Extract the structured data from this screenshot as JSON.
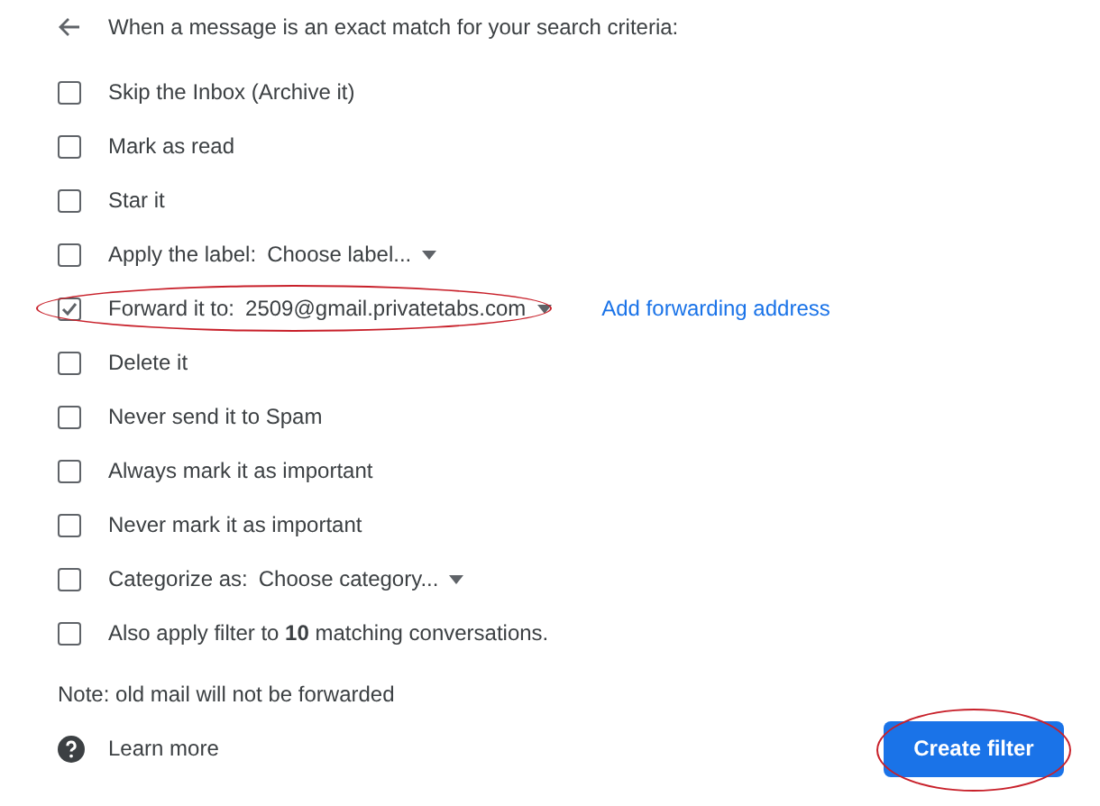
{
  "header": {
    "text": "When a message is an exact match for your search criteria:"
  },
  "actions": [
    {
      "kind": "plain",
      "label": "Skip the Inbox (Archive it)",
      "checked": false
    },
    {
      "kind": "plain",
      "label": "Mark as read",
      "checked": false
    },
    {
      "kind": "plain",
      "label": "Star it",
      "checked": false
    },
    {
      "kind": "select",
      "label": "Apply the label:",
      "value": "Choose label...",
      "checked": false
    },
    {
      "kind": "forward",
      "label": "Forward it to:",
      "value": "2509@gmail.privatetabs.com",
      "link": "Add forwarding address",
      "checked": true,
      "circled": true
    },
    {
      "kind": "plain",
      "label": "Delete it",
      "checked": false
    },
    {
      "kind": "plain",
      "label": "Never send it to Spam",
      "checked": false
    },
    {
      "kind": "plain",
      "label": "Always mark it as important",
      "checked": false
    },
    {
      "kind": "plain",
      "label": "Never mark it as important",
      "checked": false
    },
    {
      "kind": "select",
      "label": "Categorize as:",
      "value": "Choose category...",
      "checked": false
    },
    {
      "kind": "plain",
      "label": "Also apply filter to **10** matching conversations.",
      "checked": false
    }
  ],
  "note": "Note: old mail will not be forwarded",
  "learn_more": "Learn more",
  "create_button": {
    "label": "Create filter",
    "circled": true
  }
}
